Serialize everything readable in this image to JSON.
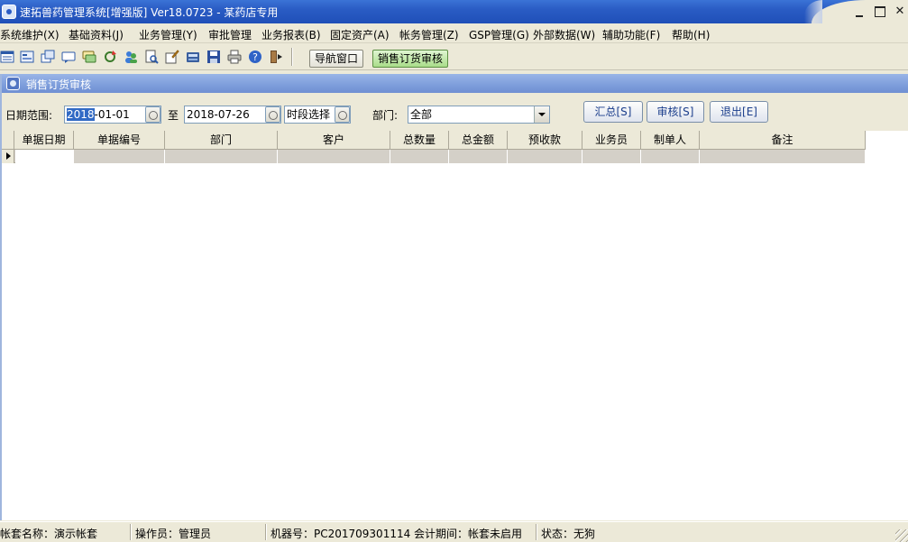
{
  "window": {
    "title": "速拓兽药管理系统[增强版] Ver18.0723  -  某药店专用"
  },
  "menu": {
    "items": [
      "系统维护(X)",
      "基础资料(J)",
      "业务管理(Y)",
      "审批管理",
      "业务报表(B)",
      "固定资产(A)",
      "帐务管理(Z)",
      "GSP管理(G)",
      "外部数据(W)",
      "辅助功能(F)",
      "帮助(H)"
    ]
  },
  "toolbar": {
    "icons": [
      "list-icon",
      "form-icon",
      "windows-icon",
      "message-icon",
      "chat-icon",
      "refresh-icon",
      "users-icon",
      "print-preview-icon",
      "edit-icon",
      "calculator-icon",
      "save-icon",
      "print-icon",
      "help-icon",
      "exit-icon"
    ],
    "nav_button": "导航窗口",
    "order_audit_button": "销售订货审核"
  },
  "child_window": {
    "title": "销售订货审核"
  },
  "filter": {
    "date_range_label": "日期范围:",
    "start_date_year": "2018",
    "start_date_rest": "-01-01",
    "to_label": "至",
    "end_date": "2018-07-26",
    "period_select": "时段选择",
    "dept_label": "部门:",
    "dept_value": "全部",
    "summary_button": "汇总[S]",
    "audit_button": "审核[S]",
    "exit_button": "退出[E]"
  },
  "grid": {
    "columns": [
      "单据日期",
      "单据编号",
      "部门",
      "客户",
      "总数量",
      "总金额",
      "预收款",
      "业务员",
      "制单人",
      "备注"
    ]
  },
  "status": {
    "account": "帐套名称：演示帐套",
    "operator": "操作员：管理员",
    "machine": "机器号：PC201709301114 会计期间：帐套未启用",
    "state": "状态：无狗"
  },
  "colors": {
    "titlebar": "#2a5cc4",
    "child_titlebar": "#7f9fdc",
    "selection": "#316ac5",
    "order_button": "#a9dd8a"
  }
}
